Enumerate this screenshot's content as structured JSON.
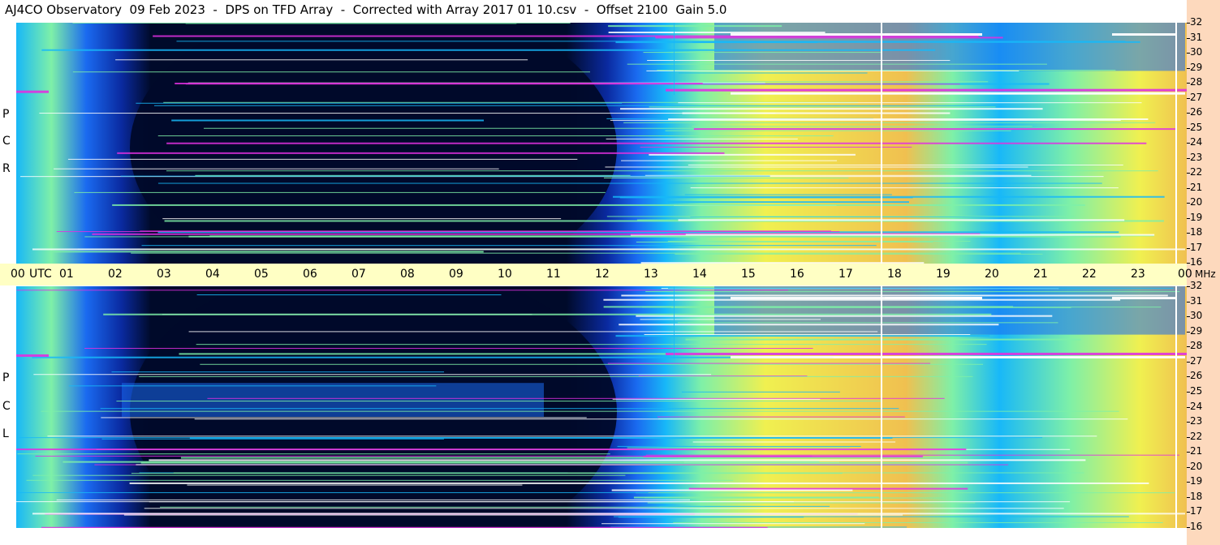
{
  "title": "AJ4CO Observatory  09 Feb 2023  -  DPS on TFD Array  -  Corrected with Array 2017 01 10.csv  -  Offset 2100  Gain 5.0",
  "chart_data": {
    "type": "heatmap",
    "panels": [
      {
        "name": "RCP",
        "letters": [
          "R",
          "C",
          "P"
        ]
      },
      {
        "name": "LCP",
        "letters": [
          "L",
          "C",
          "P"
        ]
      }
    ],
    "x_axis": {
      "unit_label": "UTC",
      "range": [
        0,
        24
      ],
      "ticks": [
        "00",
        "01",
        "02",
        "03",
        "04",
        "05",
        "06",
        "07",
        "08",
        "09",
        "10",
        "11",
        "12",
        "13",
        "14",
        "15",
        "16",
        "17",
        "18",
        "19",
        "20",
        "21",
        "22",
        "23",
        "00"
      ]
    },
    "y_axis": {
      "unit_label": "MHz",
      "range": [
        16,
        32
      ],
      "ticks": [
        32,
        31,
        30,
        29,
        28,
        27,
        26,
        25,
        24,
        23,
        22,
        21,
        20,
        19,
        18,
        17,
        16
      ]
    },
    "colors": {
      "night": "#000a2a",
      "dark_blue": "#0a2aa0",
      "blue": "#1a6af0",
      "cyan": "#18b8f8",
      "green": "#7ef0a8",
      "yellow": "#f0f050",
      "orange": "#f0c050",
      "magenta": "#e030e0",
      "white": "#ffffff"
    }
  }
}
